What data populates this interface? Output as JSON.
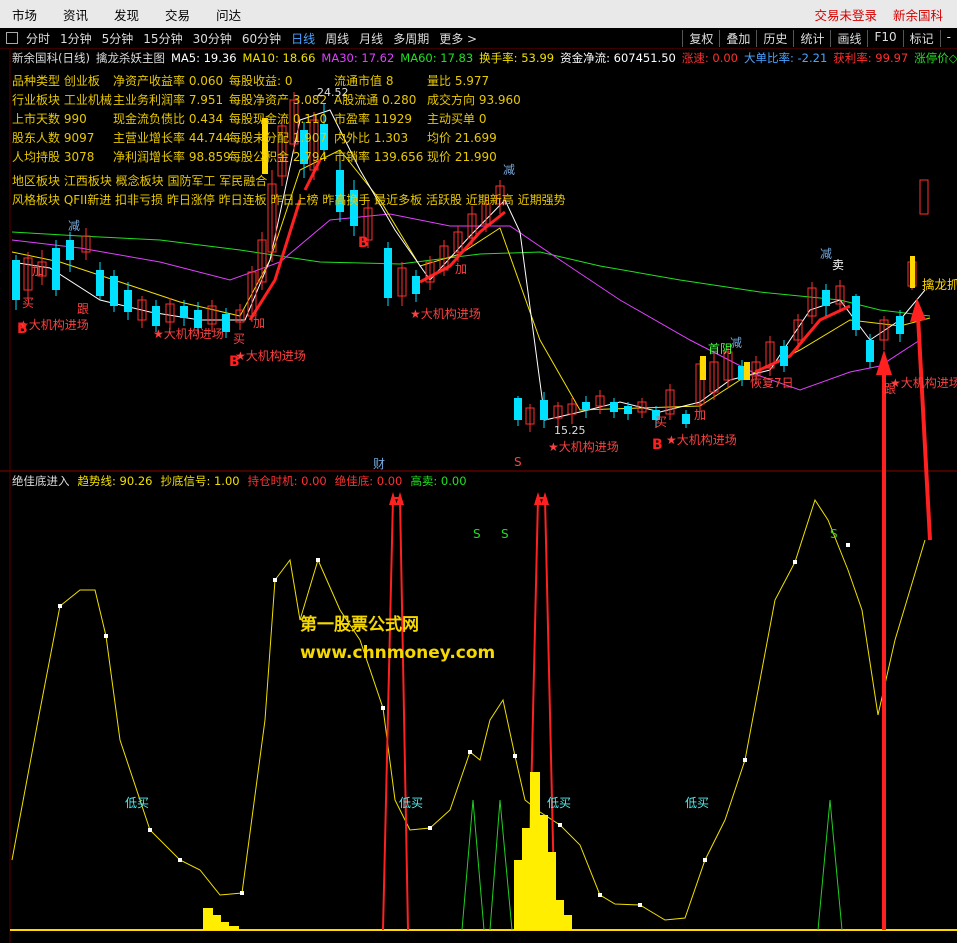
{
  "menubar": {
    "items": [
      "市场",
      "资讯",
      "发现",
      "交易",
      "问达"
    ],
    "right": [
      "交易未登录",
      "新余国科"
    ]
  },
  "timeframes": {
    "items": [
      "分时",
      "1分钟",
      "5分钟",
      "15分钟",
      "30分钟",
      "60分钟",
      "日线",
      "周线",
      "月线",
      "多周期",
      "更多 >"
    ],
    "active": "日线",
    "right_buttons": [
      "复权",
      "叠加",
      "历史",
      "统计",
      "画线",
      "F10",
      "标记",
      "-"
    ]
  },
  "header": {
    "stock": "新余国科(日线)",
    "indicator": "擒龙杀妖主图",
    "ma5": "MA5: 19.36",
    "ma10": "MA10: 18.66",
    "ma30": "MA30: 17.62",
    "ma60": "MA60: 17.83",
    "turnover": "换手率: 53.99",
    "fund_flow": "资金净流: 607451.50",
    "speed": "涨速: 0.00",
    "big_order": "大单比率: -2.21",
    "profit": "获利率: 99.97",
    "limit": "涨停价◇"
  },
  "colors": {
    "ma5": "#ffffff",
    "ma10": "#f0e000",
    "ma30": "#e040ff",
    "ma60": "#20e020",
    "up": "#ff3030",
    "down": "#00e0ff",
    "panel": "#000000"
  },
  "info": {
    "rows": [
      [
        "品种类型 创业板",
        "净资产收益率 0.060",
        "每股收益: 0",
        "流通市值 8",
        "量比 5.977"
      ],
      [
        "行业板块 工业机械",
        "主业务利润率 7.951",
        "每股净资产 3.082",
        "A股流通 0.280",
        "成交方向 93.960"
      ],
      [
        "上市天数 990",
        "现金流负债比 0.434",
        "每股现金流 0.110",
        "市盈率 11929",
        "主动买单 0"
      ],
      [
        "股东人数 9097",
        "主营业增长率 44.744",
        "每股未分配 1.907",
        "内外比 1.303",
        "均价 21.699"
      ],
      [
        "人均持股 3078",
        "净利润增长率 98.859",
        "每股公积金 2.794",
        "市销率 139.656",
        "现价 21.990"
      ]
    ],
    "region": "地区板块 江西板块  概念板块 国防军工 军民融合",
    "style": "风格板块 QFII新进 扣非亏损 昨日涨停 昨日连板 昨日上榜 昨高换手 最近多板 活跃股 近期新高 近期强势"
  },
  "chart_labels": {
    "high_price": "24.52",
    "low_price": "15.25",
    "inst": "★大机构进场",
    "jian": "减",
    "jia": "加",
    "gen": "跟",
    "mai": "卖",
    "buy_mark": "B",
    "sell_mark": "买",
    "shouyin": "首阴",
    "huifu7": "恢复7日",
    "qinlong": "擒龙抓",
    "cai": "财",
    "s_mark": "S"
  },
  "lower": {
    "title": "绝佳底进入",
    "trend": "趋势线: 90.26",
    "signal": "抄底信号: 1.00",
    "hold": "持仓时机: 0.00",
    "bottom": "绝佳底: 0.00",
    "sell": "高卖: 0.00",
    "low_buy": "低买",
    "s": "S"
  },
  "watermark": {
    "line1": "第一股票公式网",
    "line2": "www.chnmoney.com"
  },
  "chart_data": {
    "type": "candlestick",
    "title": "擒龙杀妖主图",
    "price_annotations": {
      "high": 24.52,
      "low": 15.25
    },
    "lower_indicator": {
      "type": "line",
      "name": "趋势线",
      "last": 90.26
    }
  }
}
